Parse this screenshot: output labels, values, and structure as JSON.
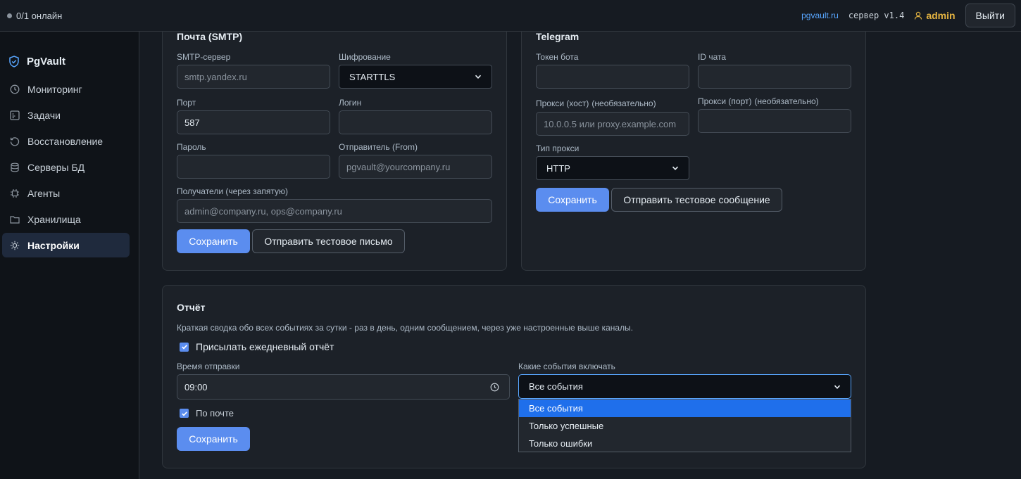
{
  "topbar": {
    "online": "0/1 онлайн",
    "site_link": "pgvault.ru",
    "version": "сервер v1.4",
    "user": "admin",
    "logout": "Выйти"
  },
  "sidebar": {
    "brand": "PgVault",
    "items": [
      {
        "label": "Мониторинг",
        "icon": "clock-icon"
      },
      {
        "label": "Задачи",
        "icon": "tasks-icon"
      },
      {
        "label": "Восстановление",
        "icon": "restore-icon"
      },
      {
        "label": "Серверы БД",
        "icon": "database-icon"
      },
      {
        "label": "Агенты",
        "icon": "chip-icon"
      },
      {
        "label": "Хранилища",
        "icon": "folder-icon"
      },
      {
        "label": "Настройки",
        "icon": "sun-icon",
        "active": true
      }
    ]
  },
  "smtp": {
    "title": "Почта (SMTP)",
    "server_label": "SMTP-сервер",
    "server_placeholder": "smtp.yandex.ru",
    "encryption_label": "Шифрование",
    "encryption_value": "STARTTLS",
    "port_label": "Порт",
    "port_value": "587",
    "login_label": "Логин",
    "login_value": "",
    "password_label": "Пароль",
    "password_value": "",
    "from_label": "Отправитель (From)",
    "from_placeholder": "pgvault@yourcompany.ru",
    "recipients_label": "Получатели (через запятую)",
    "recipients_placeholder": "admin@company.ru, ops@company.ru",
    "save": "Сохранить",
    "test": "Отправить тестовое письмо"
  },
  "telegram": {
    "title": "Telegram",
    "token_label": "Токен бота",
    "token_value": "",
    "chat_label": "ID чата",
    "chat_value": "",
    "proxy_host_label": "Прокси (хост)",
    "proxy_host_optional": "(необязательно)",
    "proxy_host_placeholder": "10.0.0.5 или proxy.example.com",
    "proxy_port_label": "Прокси (порт)",
    "proxy_port_optional": "(необязательно)",
    "proxy_port_value": "",
    "proxy_type_label": "Тип прокси",
    "proxy_type_value": "HTTP",
    "save": "Сохранить",
    "test": "Отправить тестовое сообщение"
  },
  "report": {
    "title": "Отчёт",
    "description": "Краткая сводка обо всех событиях за сутки - раз в день, одним сообщением, через уже настроенные выше каналы.",
    "daily_checkbox": "Присылать ежедневный отчёт",
    "daily_checked": true,
    "time_label": "Время отправки",
    "time_value": "09:00",
    "events_label": "Какие события включать",
    "events_value": "Все события",
    "events_options": [
      "Все события",
      "Только успешные",
      "Только ошибки"
    ],
    "email_checkbox": "По почте",
    "email_checked": true,
    "save": "Сохранить"
  },
  "colors": {
    "accent": "#5b8def",
    "user": "#e3b341",
    "link": "#58a6ff",
    "dropdown_selected": "#1f6feb"
  }
}
